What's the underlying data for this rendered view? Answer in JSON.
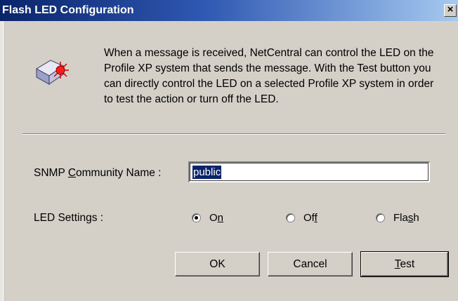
{
  "window": {
    "title": "Flash LED Configuration",
    "close_label": "×"
  },
  "description": "When a message is received, NetCentral can control the LED on the Profile XP system that sends the message. With the Test button you can directly control the LED on a selected Profile XP system in order to test the action or turn off the LED.",
  "snmp": {
    "label_pre": "SNMP ",
    "label_ul": "C",
    "label_post": "ommunity Name :",
    "value": "public"
  },
  "led": {
    "label": "LED Settings :",
    "options": [
      {
        "pre": "O",
        "ul": "n",
        "post": "",
        "checked": true
      },
      {
        "pre": "Of",
        "ul": "f",
        "post": "",
        "checked": false
      },
      {
        "pre": "Fla",
        "ul": "s",
        "post": "h",
        "checked": false
      }
    ]
  },
  "buttons": {
    "ok": "OK",
    "cancel": "Cancel",
    "test_ul": "T",
    "test_post": "est"
  },
  "icons": {
    "led_device": "led-device-icon",
    "close": "close-icon"
  },
  "colors": {
    "title_start": "#0a246a",
    "title_end": "#a6caf0",
    "face": "#d4d0c8",
    "selection": "#0a246a"
  }
}
